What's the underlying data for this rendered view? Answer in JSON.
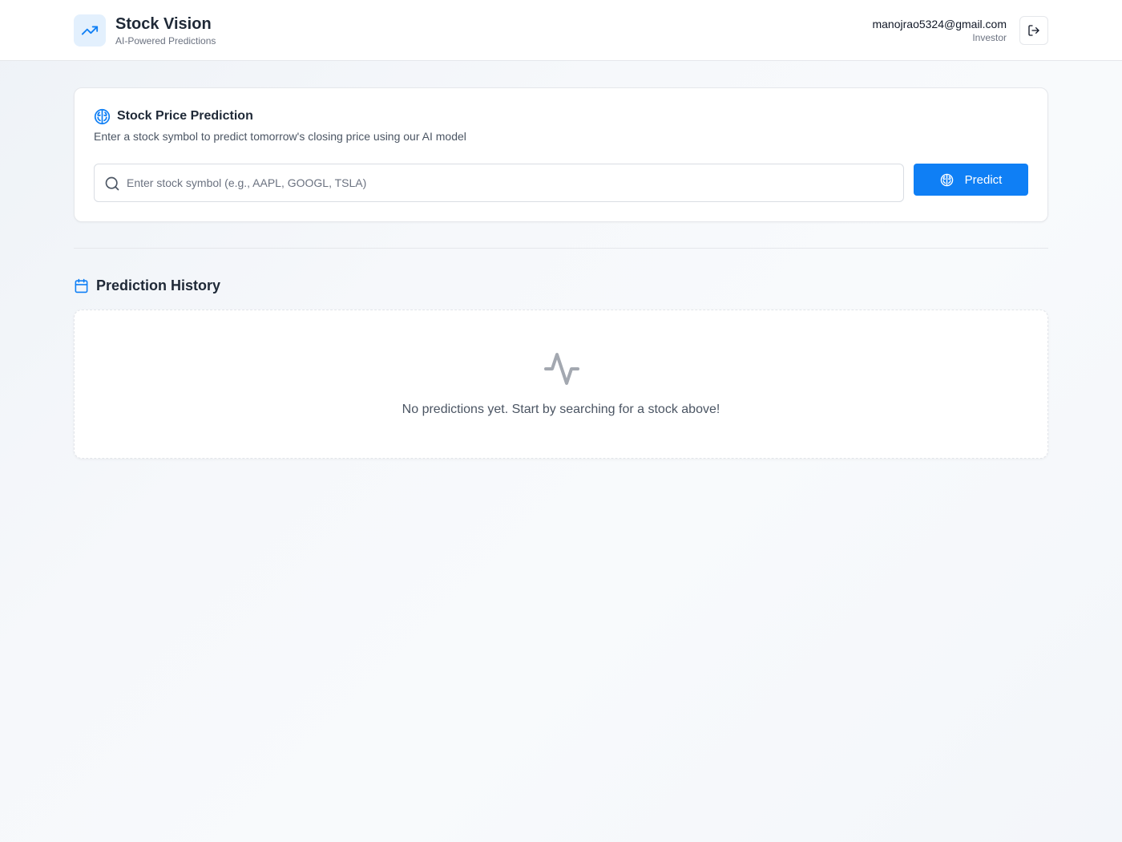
{
  "header": {
    "app_title": "Stock Vision",
    "app_subtitle": "AI-Powered Predictions",
    "logo_icon": "trending-up-icon",
    "user_email": "manojrao5324@gmail.com",
    "user_role": "Investor",
    "logout_icon": "log-out-icon"
  },
  "prediction": {
    "title": "Stock Price Prediction",
    "title_icon": "brain-icon",
    "description": "Enter a stock symbol to predict tomorrow's closing price using our AI model",
    "search_icon": "search-icon",
    "search_placeholder": "Enter stock symbol (e.g., AAPL, GOOGL, TSLA)",
    "search_value": "",
    "button_label": "Predict",
    "button_icon": "brain-icon"
  },
  "history": {
    "title": "Prediction History",
    "title_icon": "calendar-icon",
    "empty_icon": "activity-icon",
    "empty_message": "No predictions yet. Start by searching for a stock above!"
  },
  "colors": {
    "accent": "#0f7ff5",
    "logo_bg": "#e3f0fd",
    "text_primary": "#1f2937",
    "text_muted": "#6b7280"
  }
}
